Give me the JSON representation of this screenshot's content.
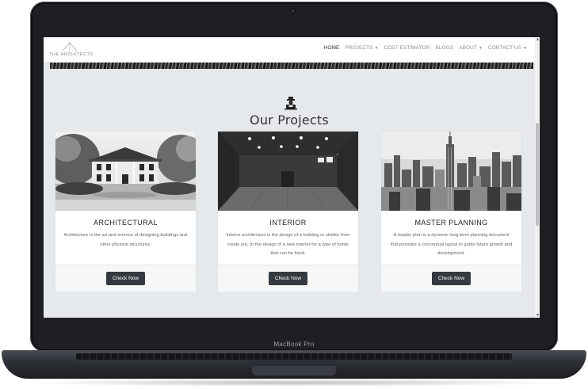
{
  "device": {
    "brand_label": "MacBook Pro"
  },
  "navbar": {
    "logo_text": "THE ARCHITECTS",
    "items": [
      {
        "label": "HOME",
        "active": true,
        "dropdown": false
      },
      {
        "label": "PROJECTS",
        "dropdown": true
      },
      {
        "label": "COST ESTIMATOR",
        "dropdown": false
      },
      {
        "label": "BLOGS",
        "dropdown": false
      },
      {
        "label": "ABOUT",
        "dropdown": true
      },
      {
        "label": "CONTACT US",
        "dropdown": true
      }
    ]
  },
  "section": {
    "title": "Our Projects",
    "icon": "architect-icon"
  },
  "cards": [
    {
      "title": "ARCHITECTURAL",
      "description": "Architecture is the art and science of designing buildings and other physical structures.",
      "button_label": "Check Now",
      "image": "mansion-photo"
    },
    {
      "title": "INTERIOR",
      "description": "Interior architecture is the design of a building or shelter from inside out, or the design of a new interior for a type of home that can be fixed.",
      "button_label": "Check Now",
      "image": "interior-hall-photo"
    },
    {
      "title": "MASTER PLANNING",
      "description": "A master plan is a dynamic long-term planning document that provides a conceptual layout to guide future growth and development.",
      "button_label": "Check Now",
      "image": "city-skyline-photo"
    }
  ],
  "colors": {
    "page_bg": "#e6e9ec",
    "button_bg": "#343a40",
    "laptop_frame": "#1d1f22"
  }
}
